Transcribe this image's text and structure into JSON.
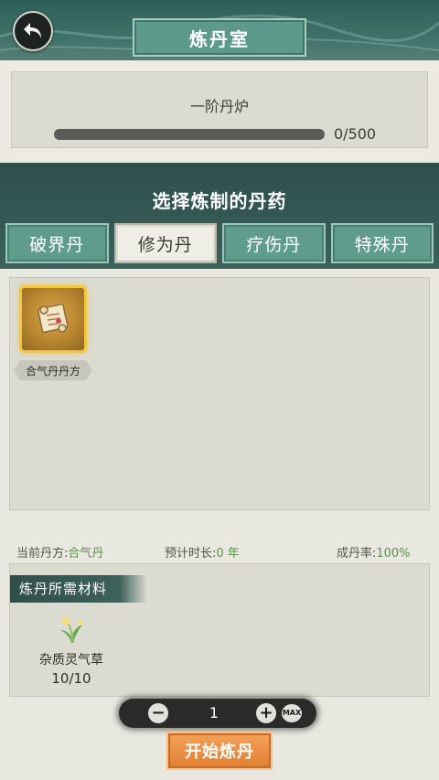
{
  "header": {
    "title": "炼丹室",
    "back_icon": "back-arrow-icon"
  },
  "furnace": {
    "name": "一阶丹炉",
    "progress_current": 0,
    "progress_max": 500,
    "progress_text": "0/500"
  },
  "selector": {
    "title": "选择炼制的丹药",
    "tabs": [
      {
        "label": "破界丹",
        "active": false
      },
      {
        "label": "修为丹",
        "active": true
      },
      {
        "label": "疗伤丹",
        "active": false
      },
      {
        "label": "特殊丹",
        "active": false
      }
    ]
  },
  "recipes": [
    {
      "name": "合气丹丹方",
      "icon": "scroll-icon",
      "selected": true
    }
  ],
  "info": {
    "current_recipe_label": "当前丹方:",
    "current_recipe_value": "合气丹",
    "duration_label": "预计时长:",
    "duration_value": "0 年",
    "success_label": "成丹率:",
    "success_value": "100%"
  },
  "materials": {
    "header": "炼丹所需材料",
    "items": [
      {
        "name": "杂质灵气草",
        "count": "10/10",
        "icon": "herb-icon"
      }
    ]
  },
  "quantity": {
    "minus": "−",
    "value": "1",
    "plus": "+",
    "max": "MAX"
  },
  "start_button": "开始炼丹",
  "colors": {
    "accent_teal": "#5f9c8c",
    "highlight_gold": "#f3c63e",
    "start_orange": "#e07f33",
    "value_green": "#5b8f4e"
  }
}
